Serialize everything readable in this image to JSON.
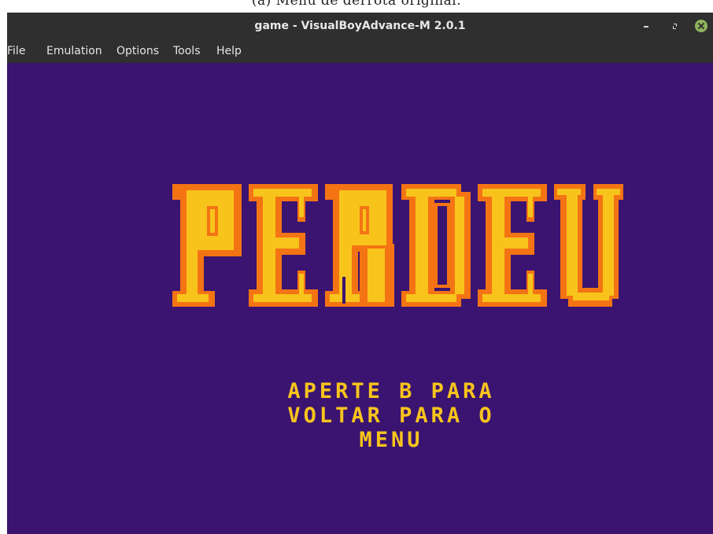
{
  "caption": {
    "text": "(a) Menu de derrota original."
  },
  "window": {
    "title": "game - VisualBoyAdvance-M 2.0.1",
    "controls": {
      "minimize_icon": "minimize-icon",
      "maximize_icon": "maximize-icon",
      "close_icon": "close-icon"
    }
  },
  "menubar": {
    "items": [
      {
        "label": "File"
      },
      {
        "label": "Emulation"
      },
      {
        "label": "Options"
      },
      {
        "label": "Tools"
      },
      {
        "label": "Help"
      }
    ]
  },
  "game": {
    "background_color": "#3a1470",
    "title_word": "PERDEU",
    "title_colors": {
      "outline": "#f47414",
      "fill": "#f8c41c",
      "shadow": "#3a1470"
    },
    "prompt_lines": [
      "APERTE B PARA",
      "VOLTAR PARA O",
      "MENU"
    ],
    "prompt_color": "#f8c41c"
  },
  "colors": {
    "titlebar": "#2f2f2f",
    "menu_text": "#e6e6e6",
    "close_button": "#8fb35c"
  }
}
